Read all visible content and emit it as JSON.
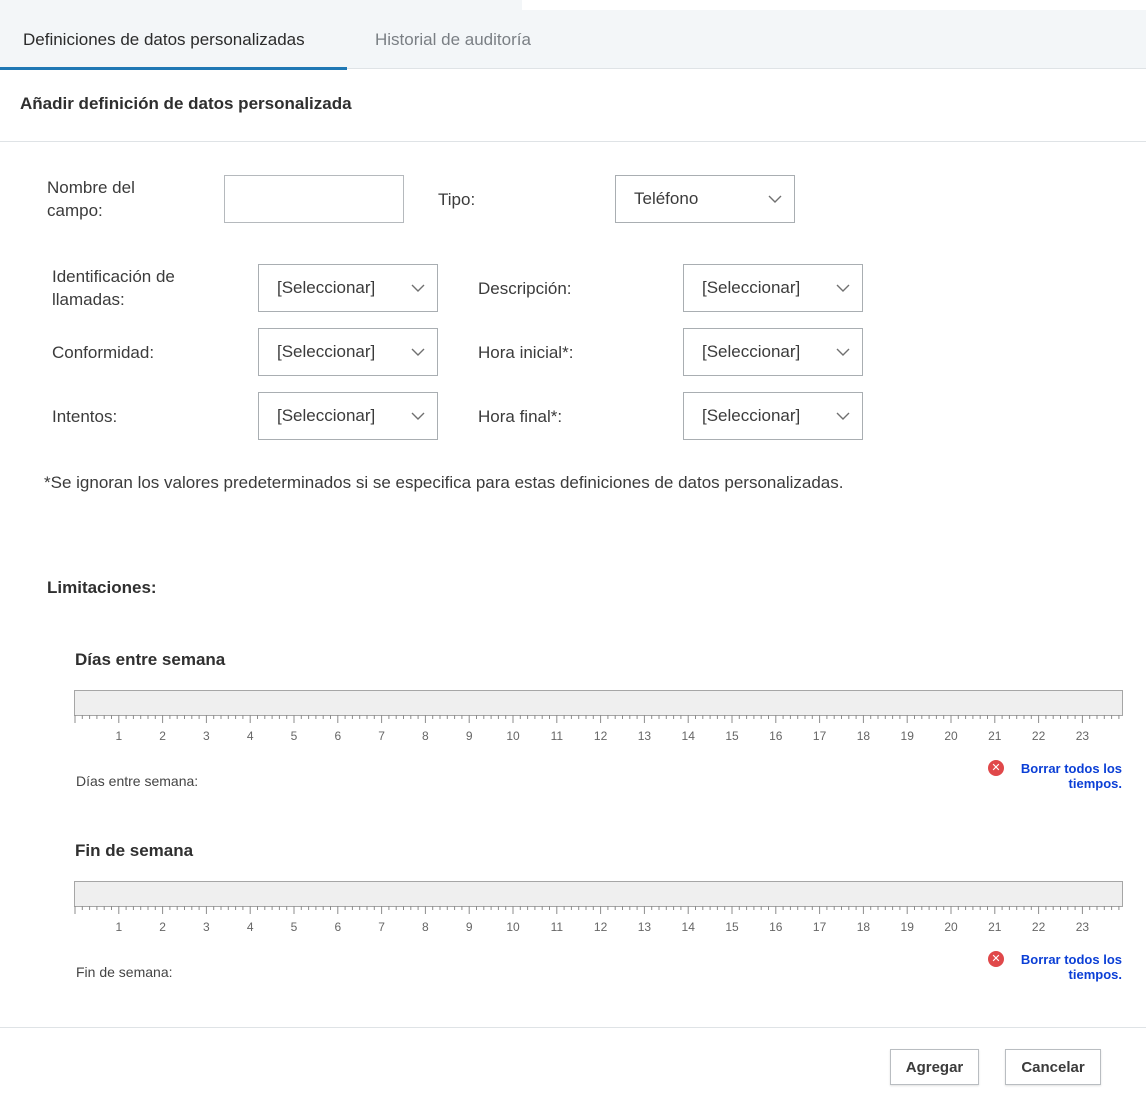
{
  "tabs": [
    {
      "label": "Definiciones de datos personalizadas",
      "active": true
    },
    {
      "label": "Historial de auditoría",
      "active": false
    }
  ],
  "section_title": "Añadir definición de datos personalizada",
  "form": {
    "field_name_label": "Nombre del campo:",
    "field_name_value": "",
    "type_label": "Tipo:",
    "type_value": "Teléfono",
    "caller_id_label": "Identificación de llamadas:",
    "caller_id_value": "[Seleccionar]",
    "description_label": "Descripción:",
    "description_value": "[Seleccionar]",
    "compliance_label": "Conformidad:",
    "compliance_value": "[Seleccionar]",
    "start_time_label": "Hora inicial*:",
    "start_time_value": "[Seleccionar]",
    "attempts_label": "Intentos:",
    "attempts_value": "[Seleccionar]",
    "end_time_label": "Hora final*:",
    "end_time_value": "[Seleccionar]"
  },
  "note": "*Se ignoran los valores predeterminados si se especifica para estas definiciones de datos personalizadas.",
  "limitations_title": "Limitaciones:",
  "schedules": [
    {
      "title": "Días entre semana",
      "label": "Días entre semana:",
      "clear_label": "Borrar todos los tiempos."
    },
    {
      "title": "Fin de semana",
      "label": "Fin de semana:",
      "clear_label": "Borrar todos los tiempos."
    }
  ],
  "ruler_hours": [
    "1",
    "2",
    "3",
    "4",
    "5",
    "6",
    "7",
    "8",
    "9",
    "10",
    "11",
    "12",
    "13",
    "14",
    "15",
    "16",
    "17",
    "18",
    "19",
    "20",
    "21",
    "22",
    "23"
  ],
  "buttons": {
    "add": "Agregar",
    "cancel": "Cancelar"
  },
  "icons": {
    "dropdown": "chevron-down-icon",
    "clear": "close-circle-icon"
  },
  "colors": {
    "tab_underline": "#1f78b4",
    "link": "#0b3fd6",
    "clear_icon": "#e0484a"
  }
}
